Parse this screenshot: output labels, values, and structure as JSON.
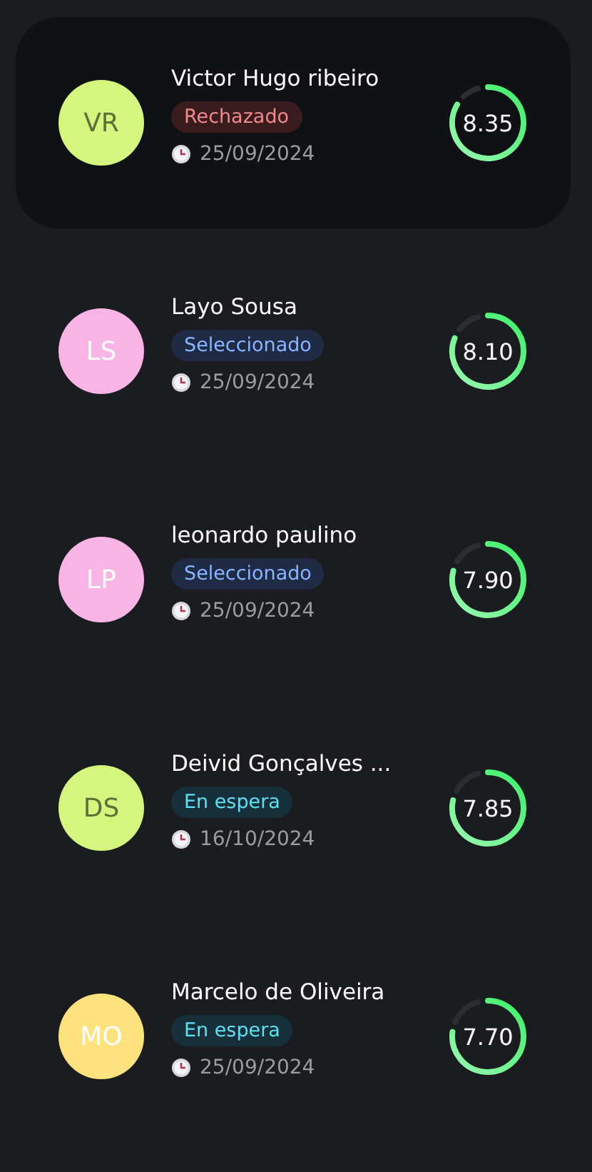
{
  "candidates": [
    {
      "initials": "VR",
      "color": "#d4f57e",
      "name": "Victor Hugo ribeiro",
      "status": {
        "kind": "rejected",
        "label": "Rechazado"
      },
      "date": "25/09/2024",
      "score": "8.35",
      "selected": true
    },
    {
      "initials": "LS",
      "color": "#f9b4e6",
      "name": "Layo Sousa",
      "status": {
        "kind": "selected",
        "label": "Seleccionado"
      },
      "date": "25/09/2024",
      "score": "8.10",
      "selected": false
    },
    {
      "initials": "LP",
      "color": "#f9b4e6",
      "name": "leonardo paulino",
      "status": {
        "kind": "selected",
        "label": "Seleccionado"
      },
      "date": "25/09/2024",
      "score": "7.90",
      "selected": false
    },
    {
      "initials": "DS",
      "color": "#d4f57e",
      "name": "Deivid Gonçalves ...",
      "status": {
        "kind": "waiting",
        "label": "En espera"
      },
      "date": "16/10/2024",
      "score": "7.85",
      "selected": false
    },
    {
      "initials": "MO",
      "color": "#fde27e",
      "name": "Marcelo de Oliveira",
      "status": {
        "kind": "waiting",
        "label": "En espera"
      },
      "date": "25/09/2024",
      "score": "7.70",
      "selected": false
    }
  ]
}
